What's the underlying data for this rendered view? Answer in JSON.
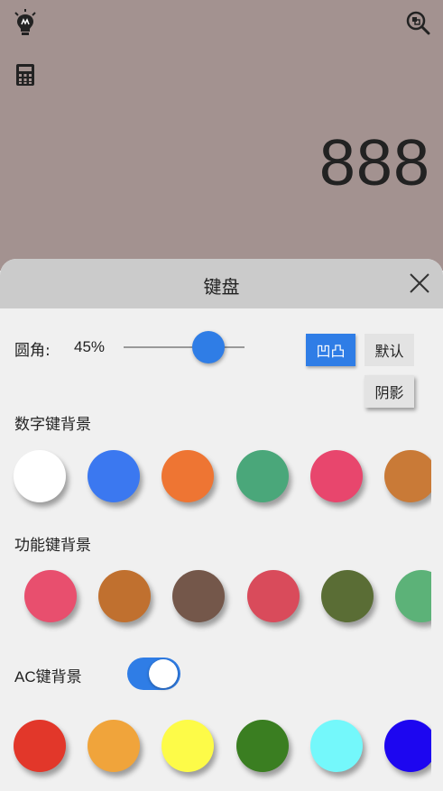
{
  "display": {
    "value": "888"
  },
  "top_icons": {
    "left": "lightbulb-icon",
    "right": "zoom-icon",
    "calc": "calculator-icon"
  },
  "sheet": {
    "title": "键盘",
    "radius": {
      "label": "圆角:",
      "value": "45%",
      "level": 0.7
    },
    "style_buttons": {
      "emboss": "凹凸",
      "default": "默认",
      "shadow": "阴影"
    },
    "digit_bg_label": "数字键背景",
    "func_bg_label": "功能键背景",
    "ac_bg_label": "AC键背景",
    "ac_toggle_on": true,
    "digit_colors": [
      "#ffffff",
      "#3b78f0",
      "#ee7533",
      "#4aa77a",
      "#e8466d",
      "#c97a37"
    ],
    "func_colors": [
      "#e84f6e",
      "#c0702f",
      "#74574a",
      "#d94b5b",
      "#5a6d35",
      "#5cb278"
    ],
    "ac_colors": [
      "#e2372a",
      "#f0a43b",
      "#fdfb48",
      "#3a7e21",
      "#74f8fb",
      "#1d06f0"
    ],
    "accent": "#2f7de6"
  }
}
